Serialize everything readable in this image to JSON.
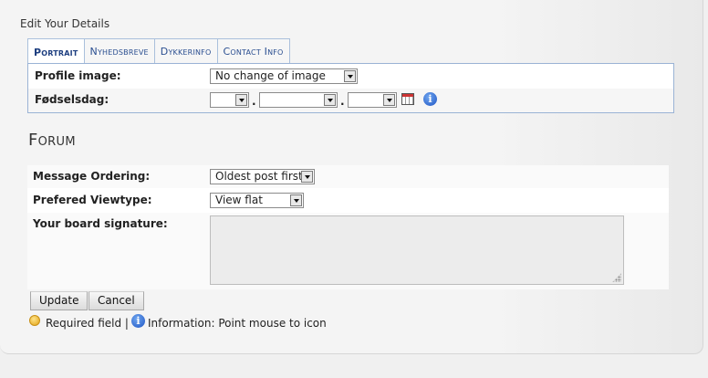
{
  "page": {
    "title": "Edit Your Details"
  },
  "tabs": [
    {
      "label": "Portrait",
      "active": true
    },
    {
      "label": "Nyhedsbreve",
      "active": false
    },
    {
      "label": "Dykkerinfo",
      "active": false
    },
    {
      "label": "Contact Info",
      "active": false
    }
  ],
  "portrait": {
    "profile_image_label": "Profile image:",
    "profile_image_value": "No change of image",
    "birthday_label": "Fødselsdag:",
    "day_value": "",
    "month_value": "",
    "year_value": "",
    "separator": "."
  },
  "forum": {
    "title": "Forum",
    "message_ordering_label": "Message Ordering:",
    "message_ordering_value": "Oldest post first",
    "viewtype_label": "Prefered Viewtype:",
    "viewtype_value": "View flat",
    "signature_label": "Your board signature:",
    "signature_value": ""
  },
  "buttons": {
    "update": "Update",
    "cancel": "Cancel"
  },
  "legend": {
    "required": "Required field |",
    "information": "Information: Point mouse to icon"
  },
  "icons": {
    "calendar": "calendar-icon",
    "info": "info-icon",
    "required": "required-icon"
  },
  "colors": {
    "tab_border": "#aac0dc",
    "tab_text": "#2a4e90",
    "info_blue": "#1f55c4",
    "required_yellow": "#e3a313"
  }
}
